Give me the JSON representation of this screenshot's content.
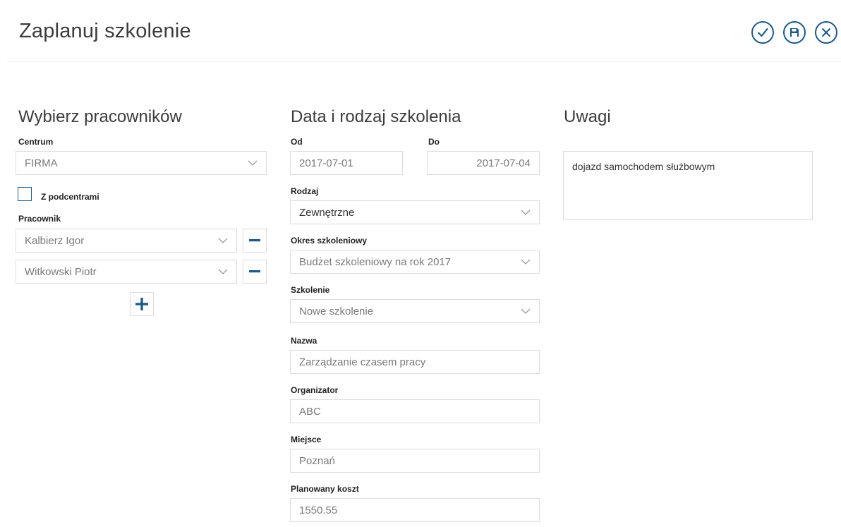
{
  "header": {
    "title": "Zaplanuj szkolenie",
    "actions": {
      "confirm_icon": "check-circle-icon",
      "save_icon": "floppy-disk-icon",
      "close_icon": "x-circle-icon"
    },
    "accent_color": "#1c5b8c"
  },
  "employees": {
    "title": "Wybierz pracowników",
    "centrum_label": "Centrum",
    "centrum_value": "FIRMA",
    "subcenters_label": "Z podcentrami",
    "subcenters_checked": false,
    "employee_label": "Pracownik",
    "employees": [
      "Kalbierz Igor",
      "Witkowski Piotr"
    ]
  },
  "training": {
    "title": "Data i rodzaj szkolenia",
    "from_label": "Od",
    "from_value": "2017-07-01",
    "to_label": "Do",
    "to_value": "2017-07-04",
    "type_label": "Rodzaj",
    "type_value": "Zewnętrzne",
    "period_label": "Okres szkoleniowy",
    "period_value": "Budżet szkoleniowy na rok 2017",
    "training_label": "Szkolenie",
    "training_value": "Nowe szkolenie",
    "name_label": "Nazwa",
    "name_value": "Zarządzanie czasem pracy",
    "organizer_label": "Organizator",
    "organizer_value": "ABC",
    "place_label": "Miejsce",
    "place_value": "Poznań",
    "cost_label": "Planowany koszt",
    "cost_value": "1550.55"
  },
  "notes": {
    "title": "Uwagi",
    "value": "dojazd samochodem służbowym"
  }
}
